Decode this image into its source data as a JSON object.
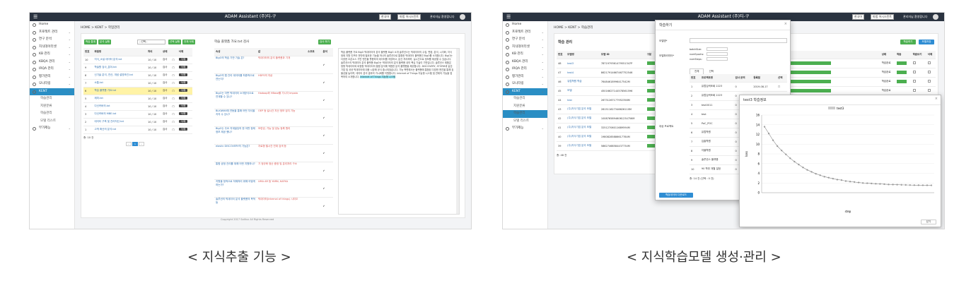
{
  "app": {
    "title": "ADAM Assistant (주)티-구",
    "user": "관리자님 환영합니다"
  },
  "header": {
    "sel1": "한국어",
    "sel2": "마법 어시스턴트"
  },
  "sidebar": {
    "items": [
      {
        "label": "Home"
      },
      {
        "label": "프로젝트 관리"
      },
      {
        "label": "연구 분석"
      },
      {
        "label": "지식데이터셋"
      },
      {
        "label": "KB 관리"
      },
      {
        "label": "KBQA 관리"
      },
      {
        "label": "IRQA 관리"
      },
      {
        "label": "평가관리"
      },
      {
        "label": "모니터링"
      },
      {
        "label": "KENT"
      },
      {
        "label": "학습관리"
      },
      {
        "label": "지원분류"
      },
      {
        "label": "학습관리"
      },
      {
        "label": "모델 리스트"
      },
      {
        "label": "부가제능"
      }
    ]
  },
  "left": {
    "breadcrumb": "HOME > KENT > 학업관리",
    "buttons": {
      "a": "학습 통계",
      "b": "분석 실행",
      "c": "선택 실행",
      "d": "전체 삭제",
      "e": "검사 하기"
    },
    "select": "--선택--",
    "table": {
      "headers": [
        "번호",
        "파일명",
        "처리",
        "상태",
        "",
        "삭제"
      ],
      "rows": [
        [
          "10",
          "지식_소설 데이터 분석.txt",
          "10 / 10",
          "검사",
          "삭제"
        ],
        [
          "9",
          "학술원 검사_분야.txt",
          "10 / 10",
          "검사",
          "삭제"
        ],
        [
          "8",
          "신기술 분석, 연산, 개념 설명조건.txt",
          "10 / 10",
          "검사",
          "삭제"
        ],
        [
          "7",
          "소통.txt",
          "10 / 10",
          "검사",
          "삭제"
        ],
        [
          "6",
          "학습 플랫폼 가요.txt",
          "10 / 10",
          "검사",
          "삭제"
        ],
        [
          "5",
          "제미.txt",
          "10 / 10",
          "검사",
          "삭제"
        ],
        [
          "4",
          "다신커버의.txt",
          "10 / 10",
          "검사",
          "삭제"
        ],
        [
          "3",
          "다신커버의 MBE.txt",
          "10 / 10",
          "검사",
          "삭제"
        ],
        [
          "2",
          "데이터 구축 및 관리지신.txt",
          "10 / 10",
          "검사",
          "삭제"
        ],
        [
          "1",
          "고객 확산의 분석.txt",
          "10 / 10",
          "검사",
          "삭제"
        ]
      ],
      "footer": "총: 10 건"
    },
    "midtitle": "학습 플랫폼 가요.txt 검사",
    "midheaders": [
      "속성",
      "값",
      "소프트",
      "분석"
    ],
    "midrows": [
      [
        "BigO의 학습 기반 기술 은?",
        "빅데이터의 분석 플랫폼과 기개",
        "✔"
      ],
      [
        "BigO의 맵 관리 데이터를 최종적으로 연는지?",
        "HDFS의 지상",
        "✔"
      ],
      [
        "BigO는 어떤 빅데이터 소개방식으로 연계할 수 있나?",
        "Hadoop와 HBase를 기시각 Impala",
        "✔"
      ],
      [
        "BLKIWIKI에 연동을 통해 어떤 지식을 지지 수 있나?",
        "OEP 등 설시간 지산 정보 검지 기능",
        "✔"
      ],
      [
        "BigO는 주요 지계빌딩의 한 어떤 정제정보 제공 했나?",
        "모련성, 기능 및 성능 등록 원리",
        "✔"
      ],
      [
        "elastic DISCOVERY의 기능은?",
        "자료형 필시간 연계 검색 등",
        "✔"
      ],
      [
        "통합 공정 관리를 위해 어떤 지원하나?",
        "기 정규화 정순 중정 및 분리처리 구소",
        "✔"
      ],
      [
        "지원을 정적으로 처해처리 위해 어떻게 하는가?",
        "UMA AR 등 YARN, KAFKA",
        "✔"
      ],
      [
        "솔루션의 빅데이터 분석 플랫폼의 목적 등",
        "빅데이터(internal of things) 시티오",
        "✔"
      ]
    ],
    "doc": "학습 플랫폼 가요 BigO 빅데이터의 분석 플랫폼 BigO 소개 솔루션스는 빅데이터의 수집, 변환, 분석, 시각화, 지식 정제 지원 인프라 전반에 필요한 기능을 하나의 솔루션으로 통합한 빅데이터 플랫폼인 BigO를 소개합니다. BigO는 다양한 오픈소스 기반 엔진을 활용하여 데이터를 저장하고, 분산 처리하며, 실시간으로 정보를 제공할 수 있습니다. 솔루션스의 빅데이터 분석 플랫폼 BigO는 빅데이터의 분석 플랫폼 내의 핵심 기술이 기반입니다. 솔루션스 제품은 정형 빅데이터와 비정형 빅데이터의 통합 분석에 적합한 분석 플랫폼을 제공합니다. DISCOVERY, STORM과 같은 기업 및 공공 빅데이터에 대응 시장에 공식 출시되었습니다. 기능 측면에서는 플랫폼에 통합된 다양한 엔진을 통해 효율성을 높이며, 데이터 분석 결과의 가시화를 지원합니다. Internet of Things 지능형 시스템 및 관제의 기능을 접목하여 소개합니다.",
    "copyright": "Copyright 2017 Saltlux All Rights Reserved"
  },
  "right": {
    "breadcrumb": "HOME > KENT > 학습관리",
    "pagetitle": "학습 관리",
    "buttons": {
      "a": "학습하기",
      "b": "모델저장"
    },
    "table": {
      "headers": [
        "번호",
        "모델명",
        "모델 ID",
        "구분",
        "상태",
        "학습",
        "학습보기",
        "삭제"
      ],
      "rows": [
        [
          "48",
          "test3",
          "7871979361479551347P",
          "학습완료"
        ],
        [
          "47",
          "test4",
          "86217914667467752546",
          "학습완료"
        ],
        [
          "46",
          "유럽학원 학습",
          "76484618996417542M",
          "학습완료"
        ],
        [
          "45",
          "모델",
          "45016627144578561596",
          "학습완료"
        ],
        [
          "44",
          "test",
          "26731267177952358M",
          "학습완료"
        ],
        [
          "43",
          "(주)지식기업 분석 모델",
          "28151162734662611SM",
          "학습완료"
        ],
        [
          "42",
          "(주)지식기업 분석 모델",
          "10087658946061234756M",
          "학습완료"
        ],
        [
          "41",
          "(주)지식기업 분석 모델",
          "32512706011689594M",
          "학습완료"
        ],
        [
          "40",
          "(주)지식기업 분석 모델",
          "19808285886617784M",
          "학습완료"
        ],
        [
          "39",
          "(주)지식기업 분석 모델",
          "58627468584437734M",
          "학습완료"
        ]
      ],
      "progress": "100% 학습",
      "footer": "총: 48 건"
    },
    "modal": {
      "title": "학습하기",
      "model_label": "모델명*",
      "params_label": "모델파라미터*",
      "params": [
        "batchSize:",
        "numEpochs:",
        "numSteps:"
      ],
      "tabs": [
        "전체",
        "선택"
      ],
      "data_label": "대상 프로젝트",
      "headers": [
        "번호",
        "프로젝트명",
        "검사 문의",
        "등록일",
        "선택"
      ],
      "rows": [
        [
          "1",
          "유럽입력조회 2223",
          "0",
          "2019-08-17"
        ],
        [
          "2",
          "유럽입력조회 2223",
          "0",
          "2019-08-05"
        ],
        [
          "3",
          "test0011",
          "0",
          ""
        ],
        [
          "4",
          "test",
          "0",
          ""
        ],
        [
          "5",
          "PoC_POC",
          "0",
          ""
        ],
        [
          "6",
          "유럽학원",
          "0",
          ""
        ],
        [
          "7",
          "입출학원",
          "0",
          ""
        ],
        [
          "8",
          "자율학원",
          "0",
          ""
        ],
        [
          "9",
          "솔루션스 플랫폼",
          "0",
          ""
        ],
        [
          "10",
          "90 학부 개월 일정 ",
          "0",
          ""
        ]
      ],
      "footer": "총: 14 건 (선택 : 0 건)",
      "submit": "학습데이터 다운로드"
    },
    "chart_modal": {
      "title": "test3 학습정보",
      "close": "닫기"
    }
  },
  "chart_data": {
    "type": "line",
    "title": "",
    "legend": [
      "test3"
    ],
    "xlabel": "step",
    "ylabel": "loss",
    "ylim": [
      0,
      16
    ],
    "yticks": [
      0,
      2,
      4,
      6,
      8,
      10,
      12,
      14,
      16
    ],
    "series": [
      {
        "name": "test3",
        "values": [
          13.6,
          12.2,
          10.8,
          9.6,
          8.7,
          7.9,
          7.1,
          6.4,
          5.8,
          5.2,
          4.7,
          4.3,
          3.9,
          3.6,
          3.3,
          3.1,
          2.9,
          2.7,
          2.6,
          2.4,
          2.3,
          2.2,
          2.1,
          2.0,
          1.95,
          1.9,
          1.85,
          1.8,
          1.75,
          1.7,
          1.68,
          1.65,
          1.62,
          1.6,
          1.58,
          1.56,
          1.55,
          1.54,
          1.53,
          1.52
        ]
      }
    ],
    "grid": true
  },
  "captions": {
    "left": "< 지식추출 기능 >",
    "right": "< 지식학습모델 생성·관리 >"
  }
}
